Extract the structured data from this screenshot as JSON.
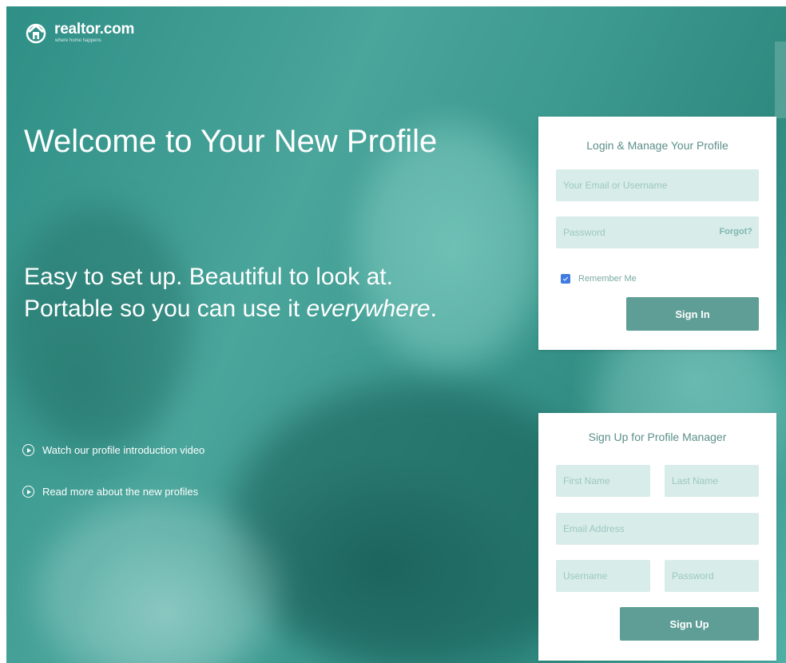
{
  "brand": {
    "name": "realtor.com",
    "tagline": "where home happens"
  },
  "hero": {
    "headline": "Welcome to Your New Profile",
    "subhead_start": "Easy to set up. Beautiful to look at. Portable so you can use it ",
    "subhead_emphasis": "everywhere",
    "subhead_end": ".",
    "links": [
      {
        "label": "Watch our profile introduction video",
        "icon": "play-circle-icon"
      },
      {
        "label": "Read more about the new profiles",
        "icon": "play-circle-icon"
      }
    ]
  },
  "login": {
    "title": "Login & Manage Your Profile",
    "email_placeholder": "Your Email or Username",
    "password_placeholder": "Password",
    "forgot_label": "Forgot?",
    "remember_label": "Remember Me",
    "remember_checked": true,
    "submit_label": "Sign In"
  },
  "signup": {
    "title": "Sign Up for Profile Manager",
    "first_name_placeholder": "First Name",
    "last_name_placeholder": "Last Name",
    "email_placeholder": "Email Address",
    "username_placeholder": "Username",
    "password_placeholder": "Password",
    "submit_label": "Sign Up"
  },
  "colors": {
    "accent": "#5f9e96",
    "field_bg": "#d8ece9",
    "panel_title": "#5b8f89",
    "checkbox": "#3f7be0"
  }
}
